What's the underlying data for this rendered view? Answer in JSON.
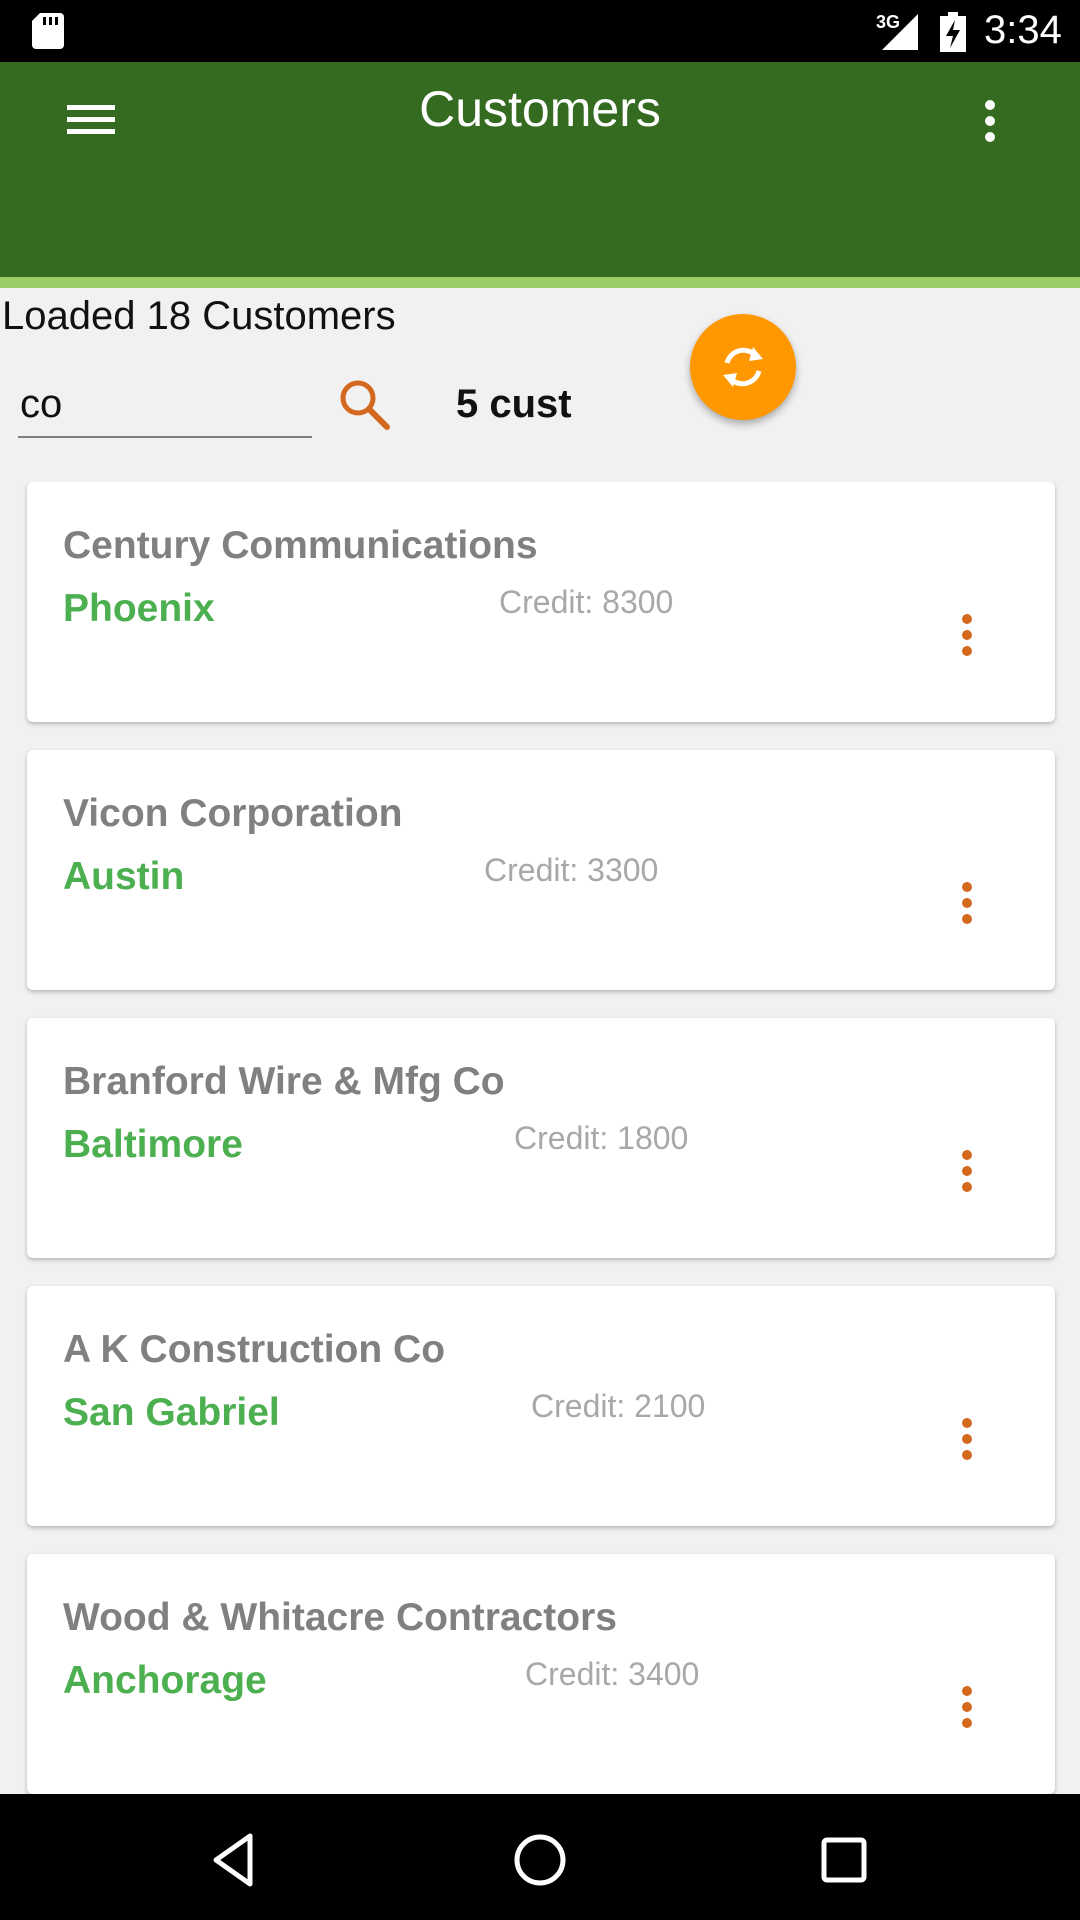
{
  "status_bar": {
    "network": "3G",
    "time": "3:34",
    "icons": [
      "sd-card-icon",
      "signal-icon",
      "battery-charging-icon"
    ]
  },
  "app_bar": {
    "title": "Customers",
    "menu_icon": "hamburger-menu-icon",
    "overflow_icon": "more-vert-icon"
  },
  "status_text": "Loaded 18 Customers",
  "search": {
    "value": "co",
    "placeholder": "",
    "icon": "search-icon"
  },
  "result_count": "5 cust",
  "fab": {
    "icon": "refresh-icon",
    "color": "#ff9800"
  },
  "customers": [
    {
      "name": "Century Communications",
      "city": "Phoenix",
      "credit": "Credit: 8300"
    },
    {
      "name": "Vicon Corporation",
      "city": "Austin",
      "credit": "Credit: 3300"
    },
    {
      "name": "Branford Wire & Mfg Co",
      "city": "Baltimore",
      "credit": "Credit: 1800"
    },
    {
      "name": "A K Construction Co",
      "city": "San Gabriel",
      "credit": "Credit: 2100"
    },
    {
      "name": "Wood & Whitacre Contractors",
      "city": "Anchorage",
      "credit": "Credit: 3400"
    }
  ],
  "colors": {
    "app_bar": "#356b20",
    "accent_line": "#9ccc65",
    "city_text": "#4caf50",
    "name_text": "#808080",
    "icon_accent": "#d2691e"
  },
  "nav_bar": {
    "back_icon": "back-triangle-icon",
    "home_icon": "home-circle-icon",
    "recents_icon": "recents-square-icon"
  }
}
